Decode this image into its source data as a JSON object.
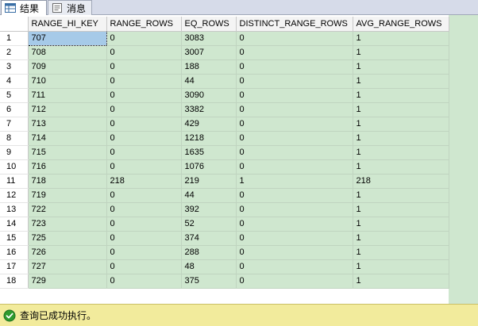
{
  "tabs": [
    {
      "label": "结果",
      "icon": "results-grid-icon",
      "active": true
    },
    {
      "label": "消息",
      "icon": "messages-icon",
      "active": false
    }
  ],
  "grid": {
    "columns": [
      "RANGE_HI_KEY",
      "RANGE_ROWS",
      "EQ_ROWS",
      "DISTINCT_RANGE_ROWS",
      "AVG_RANGE_ROWS"
    ],
    "rows": [
      {
        "num": "1",
        "cells": [
          "707",
          "0",
          "3083",
          "0",
          "1"
        ]
      },
      {
        "num": "2",
        "cells": [
          "708",
          "0",
          "3007",
          "0",
          "1"
        ]
      },
      {
        "num": "3",
        "cells": [
          "709",
          "0",
          "188",
          "0",
          "1"
        ]
      },
      {
        "num": "4",
        "cells": [
          "710",
          "0",
          "44",
          "0",
          "1"
        ]
      },
      {
        "num": "5",
        "cells": [
          "711",
          "0",
          "3090",
          "0",
          "1"
        ]
      },
      {
        "num": "6",
        "cells": [
          "712",
          "0",
          "3382",
          "0",
          "1"
        ]
      },
      {
        "num": "7",
        "cells": [
          "713",
          "0",
          "429",
          "0",
          "1"
        ]
      },
      {
        "num": "8",
        "cells": [
          "714",
          "0",
          "1218",
          "0",
          "1"
        ]
      },
      {
        "num": "9",
        "cells": [
          "715",
          "0",
          "1635",
          "0",
          "1"
        ]
      },
      {
        "num": "10",
        "cells": [
          "716",
          "0",
          "1076",
          "0",
          "1"
        ]
      },
      {
        "num": "11",
        "cells": [
          "718",
          "218",
          "219",
          "1",
          "218"
        ]
      },
      {
        "num": "12",
        "cells": [
          "719",
          "0",
          "44",
          "0",
          "1"
        ]
      },
      {
        "num": "13",
        "cells": [
          "722",
          "0",
          "392",
          "0",
          "1"
        ]
      },
      {
        "num": "14",
        "cells": [
          "723",
          "0",
          "52",
          "0",
          "1"
        ]
      },
      {
        "num": "15",
        "cells": [
          "725",
          "0",
          "374",
          "0",
          "1"
        ]
      },
      {
        "num": "16",
        "cells": [
          "726",
          "0",
          "288",
          "0",
          "1"
        ]
      },
      {
        "num": "17",
        "cells": [
          "727",
          "0",
          "48",
          "0",
          "1"
        ]
      },
      {
        "num": "18",
        "cells": [
          "729",
          "0",
          "375",
          "0",
          "1"
        ]
      }
    ]
  },
  "status": {
    "icon": "success-check-icon",
    "text": "查询已成功执行。"
  },
  "colors": {
    "grid_background": "#cfe7cf",
    "selected_cell": "#a6cae8",
    "status_background": "#f2eb9c",
    "success_icon": "#2e9b2e"
  }
}
